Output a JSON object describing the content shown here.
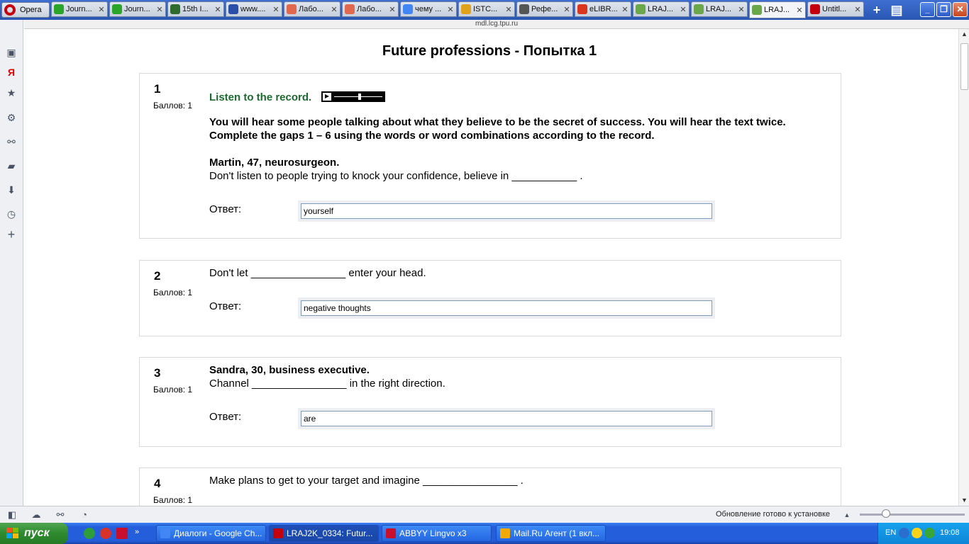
{
  "browser": {
    "menu_label": "Opera",
    "tabs": [
      {
        "label": "Journ...",
        "color": "#2aa52a",
        "active": false
      },
      {
        "label": "Journ...",
        "color": "#2aa52a",
        "active": false
      },
      {
        "label": "15th I...",
        "color": "#2f6b2f",
        "active": false
      },
      {
        "label": "www....",
        "color": "#2b4fa8",
        "active": false
      },
      {
        "label": "Лабо...",
        "color": "#e0684f",
        "active": false
      },
      {
        "label": "Лабо...",
        "color": "#e0684f",
        "active": false
      },
      {
        "label": "чему ...",
        "color": "#4285f4",
        "active": false
      },
      {
        "label": "ISTC...",
        "color": "#e0a21a",
        "active": false
      },
      {
        "label": "Рефе...",
        "color": "#555555",
        "active": false
      },
      {
        "label": "eLIBR...",
        "color": "#d9361d",
        "active": false
      },
      {
        "label": "LRAJ...",
        "color": "#6aa64a",
        "active": false
      },
      {
        "label": "LRAJ...",
        "color": "#6aa64a",
        "active": false
      },
      {
        "label": "LRAJ...",
        "color": "#6aa64a",
        "active": true
      },
      {
        "label": "Untitl...",
        "color": "#c4000f",
        "active": false
      }
    ],
    "close_glyph": "✕",
    "url": "mdl.lcg.tpu.ru"
  },
  "page": {
    "title": "Future professions - Попытка 1",
    "answer_label": "Ответ:",
    "q1": {
      "number": "1",
      "points": "Баллов: 1",
      "listen": "Listen to the record.",
      "instructions": "You will hear some people talking about what they believe to be the secret of success. You will hear the text twice. Complete the gaps 1 – 6 using the words or word combinations according to the record.",
      "speaker": "Martin, 47, neurosurgeon.",
      "text": "Don't listen to people trying to knock your confidence, believe in ___________ .",
      "answer": "yourself"
    },
    "q2": {
      "number": "2",
      "points": "Баллов: 1",
      "text": "Don't let ________________ enter your head.",
      "answer": "negative thoughts"
    },
    "q3": {
      "number": "3",
      "points": "Баллов: 1",
      "speaker": "Sandra, 30, business executive.",
      "text": "Channel ________________ in the right direction.",
      "answer": "are"
    },
    "q4": {
      "number": "4",
      "points": "Баллов: 1",
      "text": "Make plans to get to your target and imagine ________________ ."
    }
  },
  "statusbar": {
    "update_message": "Обновление готово к установке",
    "zoom_level": 0.25
  },
  "taskbar": {
    "start_label": "пуск",
    "tasks": [
      {
        "label": "Диалоги - Google Ch...",
        "color": "#4285f4"
      },
      {
        "label": "LRAJ2K_0334: Futur...",
        "color": "#c4000f"
      },
      {
        "label": "ABBYY Lingvo x3",
        "color": "#c8102e"
      },
      {
        "label": "Mail.Ru Агент (1 вкл...",
        "color": "#f2a900"
      }
    ],
    "language": "EN",
    "clock": "19:08"
  }
}
